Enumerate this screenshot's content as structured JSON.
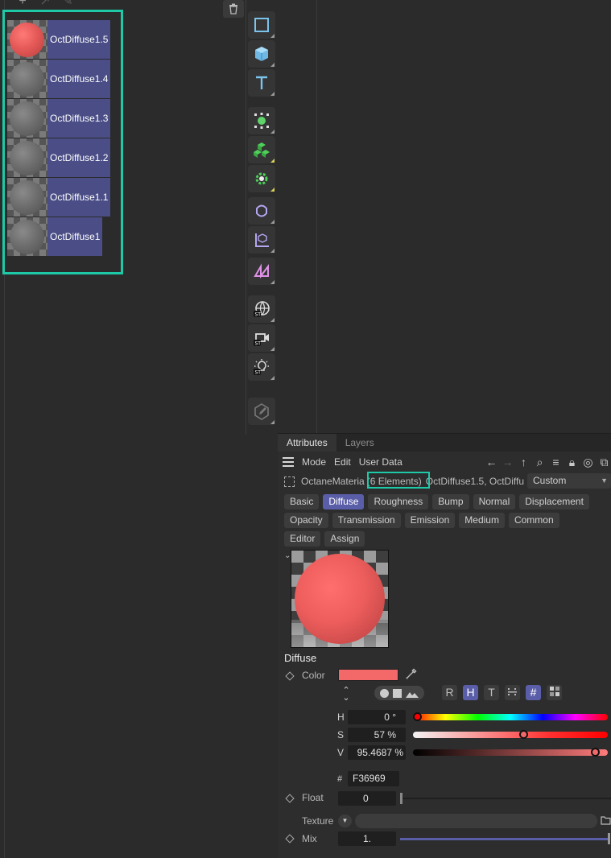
{
  "materials": [
    {
      "name": "OctDiffuse1.5",
      "preview": "red"
    },
    {
      "name": "OctDiffuse1.4",
      "preview": "gray"
    },
    {
      "name": "OctDiffuse1.3",
      "preview": "gray"
    },
    {
      "name": "OctDiffuse1.2",
      "preview": "gray"
    },
    {
      "name": "OctDiffuse1.1",
      "preview": "gray"
    },
    {
      "name": "OctDiffuse1",
      "preview": "gray"
    }
  ],
  "material_toolbar": {
    "icons": [
      "plus-icon",
      "arrow-up-right-icon",
      "eyedropper-icon",
      "trash-icon"
    ]
  },
  "toolbar_icons": [
    "cube-outline-icon",
    "cube-icon",
    "text-icon",
    "spline-points-icon",
    "mograph-cloner-icon",
    "generator-gear-icon",
    "deformer-icon",
    "field-axis-icon",
    "scene-node-icon",
    "sky-globe-icon",
    "camera-icon",
    "light-icon",
    "edit-pen-icon"
  ],
  "attributes": {
    "tabs": [
      "Attributes",
      "Layers"
    ],
    "menu": [
      "Mode",
      "Edit",
      "User Data"
    ],
    "object_type": "OctaneMateria",
    "elements_count": "(6 Elements)",
    "object_names": "OctDiffuse1.5, OctDiffu",
    "preset": "Custom",
    "channel_tabs_row1": [
      "Basic",
      "Diffuse",
      "Roughness",
      "Bump",
      "Normal",
      "Displacement"
    ],
    "channel_tabs_row2": [
      "Opacity",
      "Transmission",
      "Emission",
      "Medium",
      "Common"
    ],
    "channel_tabs_row3": [
      "Editor",
      "Assign"
    ],
    "active_tab": "Diffuse",
    "section_title": "Diffuse",
    "color_label": "Color",
    "color_value": "#f36969",
    "color_mode_buttons": [
      "R",
      "H",
      "T",
      "#"
    ],
    "h_label": "H",
    "h_value": "0 °",
    "h_fraction": 0.0,
    "s_label": "S",
    "s_value": "57 %",
    "s_fraction": 0.57,
    "v_label": "V",
    "v_value": "95.4687 %",
    "v_fraction": 0.9547,
    "hex_hash": "#",
    "hex_value": "F36969",
    "float_label": "Float",
    "float_value": "0",
    "float_fraction": 0.0,
    "texture_label": "Texture",
    "mix_label": "Mix",
    "mix_value": "1.",
    "mix_fraction": 1.0
  },
  "colors": {
    "accent": "#5a5ea8",
    "highlight": "#1ec9a7",
    "label_bg": "#4a4d86",
    "swatch": "#f36969"
  }
}
